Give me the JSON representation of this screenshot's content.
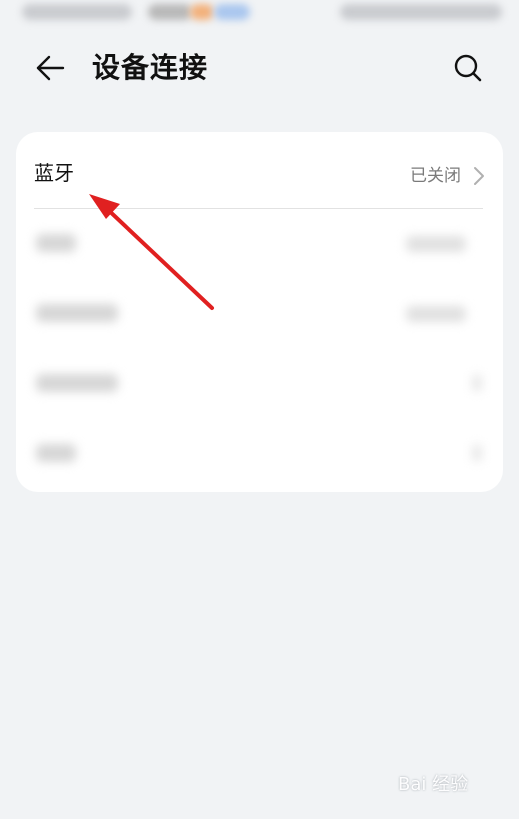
{
  "header": {
    "title": "设备连接",
    "back_icon": "arrow-left-icon",
    "search_icon": "search-icon"
  },
  "settings_list": {
    "bluetooth": {
      "label": "蓝牙",
      "value": "已关闭"
    }
  },
  "annotation": {
    "color": "#e02020"
  },
  "watermark": {
    "text": "Bai 经验"
  },
  "colors": {
    "background": "#f1f3f5",
    "card": "#ffffff",
    "secondary_text": "#7a7a7a",
    "primary_text": "#111111"
  }
}
